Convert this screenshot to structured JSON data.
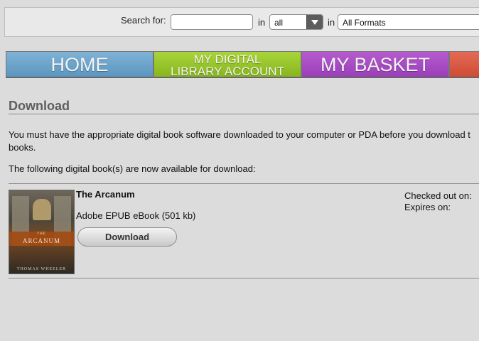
{
  "search": {
    "label": "Search for:",
    "query_value": "",
    "in_label_1": "in",
    "scope_value": "all",
    "in_label_2": "in",
    "format_value": "All Formats"
  },
  "nav": {
    "home": "HOME",
    "account_line1": "MY DIGITAL",
    "account_line2": "LIBRARY ACCOUNT",
    "basket": "MY BASKET"
  },
  "download": {
    "title": "Download",
    "instructions_line1": "You must have the appropriate digital book software downloaded to your computer or PDA before you download t",
    "instructions_line2": "books.",
    "available_text": "The following digital book(s) are now available for download:"
  },
  "book": {
    "title": "The Arcanum",
    "format": "Adobe EPUB eBook (501 kb)",
    "download_label": "Download",
    "checked_out_label": "Checked out on:",
    "expires_label": "Expires on:",
    "cover_the": "THE",
    "cover_title": "ARCANUM",
    "cover_author": "THOMAS WHEELER"
  }
}
